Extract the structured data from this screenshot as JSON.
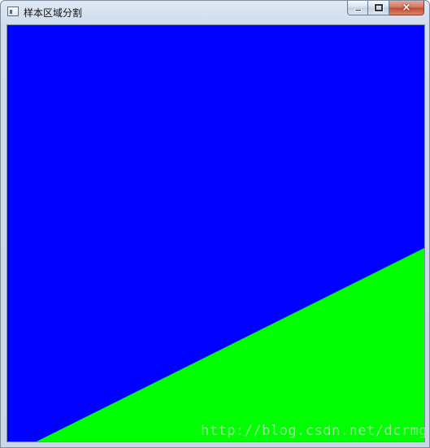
{
  "window": {
    "title": "样本区域分割",
    "caption_buttons": {
      "minimize": "minimize",
      "maximize": "maximize",
      "close": "×"
    }
  },
  "canvas": {
    "regions": [
      {
        "name": "blue-region",
        "color": "#0000ff"
      },
      {
        "name": "green-region",
        "color": "#00ff00"
      }
    ]
  },
  "watermark": "http://blog.csdn.net/dcrmg",
  "colors": {
    "blue": "#0000ff",
    "green": "#00ff00",
    "frame": "#c9d7e8",
    "close_button": "#c04a32"
  }
}
